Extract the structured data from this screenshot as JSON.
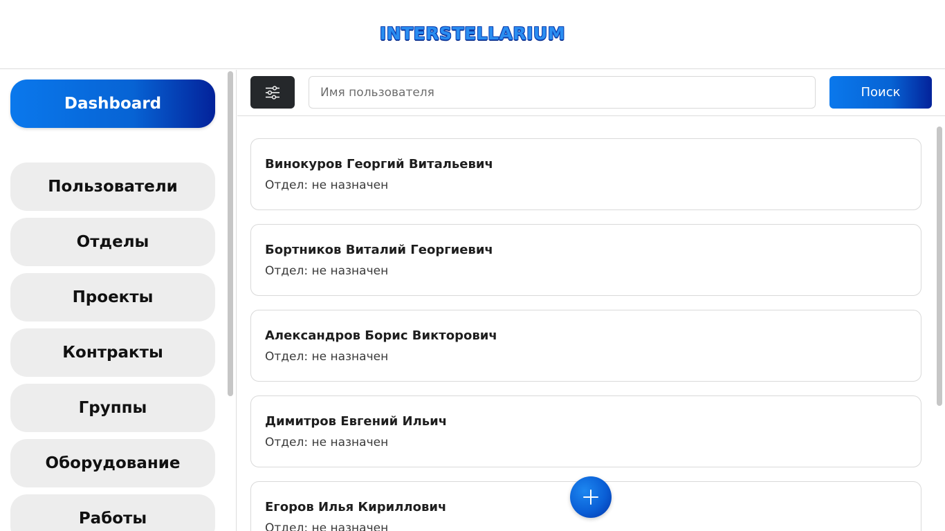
{
  "header": {
    "logo_text": "INTERSTELLARIUM"
  },
  "sidebar": {
    "items": [
      {
        "label": "Dashboard",
        "active": true
      },
      {
        "label": "Пользователи",
        "active": false
      },
      {
        "label": "Отделы",
        "active": false
      },
      {
        "label": "Проекты",
        "active": false
      },
      {
        "label": "Контракты",
        "active": false
      },
      {
        "label": "Группы",
        "active": false
      },
      {
        "label": "Оборудование",
        "active": false
      },
      {
        "label": "Работы",
        "active": false
      }
    ]
  },
  "toolbar": {
    "filter_icon": "sliders-icon",
    "search_placeholder": "Имя пользователя",
    "search_value": "",
    "search_button_label": "Поиск"
  },
  "users": [
    {
      "name": "Винокуров Георгий Витальевич",
      "department": "Отдел: не назначен"
    },
    {
      "name": "Бортников Виталий Георгиевич",
      "department": "Отдел: не назначен"
    },
    {
      "name": "Александров Борис Викторович",
      "department": "Отдел: не назначен"
    },
    {
      "name": "Димитров Евгений Ильич",
      "department": "Отдел: не назначен"
    },
    {
      "name": "Егоров Илья Кириллович",
      "department": "Отдел: не назначен"
    }
  ],
  "fab": {
    "icon": "plus-icon"
  },
  "colors": {
    "accent_start": "#0a78ec",
    "accent_end": "#03229a",
    "filter_button": "#25282b",
    "nav_inactive": "#ededed"
  }
}
